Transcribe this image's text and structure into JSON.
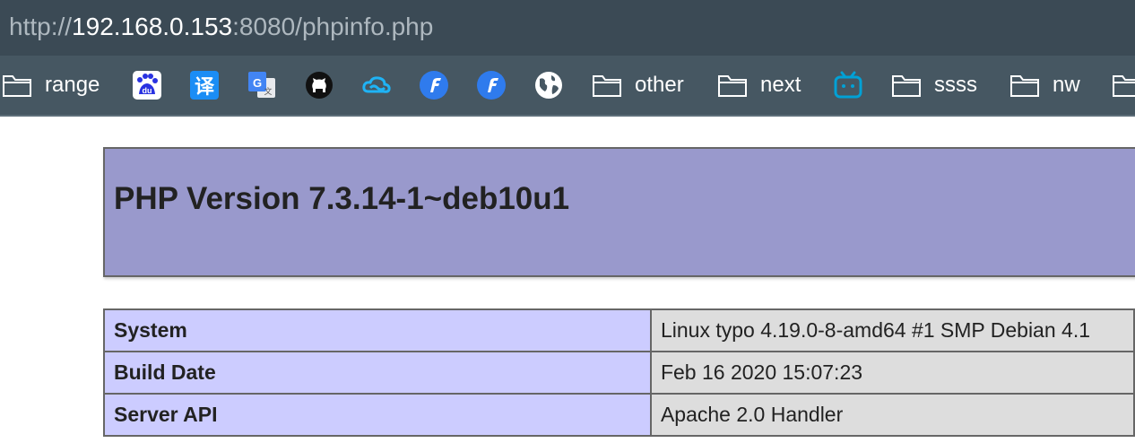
{
  "browser": {
    "url": {
      "scheme": "http://",
      "host": "192.168.0.153",
      "rest": ":8080/phpinfo.php"
    },
    "bookmarks": [
      {
        "type": "folder",
        "label": "range",
        "icon": "folder-icon"
      },
      {
        "type": "site",
        "icon": "baidu-icon",
        "glyph": "du"
      },
      {
        "type": "site",
        "icon": "translate-icon",
        "glyph": "译"
      },
      {
        "type": "site",
        "icon": "google-translate-icon",
        "glyph": "G"
      },
      {
        "type": "site",
        "icon": "github-icon"
      },
      {
        "type": "site",
        "icon": "cloud-icon"
      },
      {
        "type": "site",
        "icon": "f-app-icon"
      },
      {
        "type": "site",
        "icon": "f-app-icon"
      },
      {
        "type": "site",
        "icon": "globe-icon"
      },
      {
        "type": "folder",
        "label": "other",
        "icon": "folder-icon"
      },
      {
        "type": "folder",
        "label": "next",
        "icon": "folder-icon"
      },
      {
        "type": "site",
        "icon": "bilibili-icon"
      },
      {
        "type": "folder",
        "label": "ssss",
        "icon": "folder-icon"
      },
      {
        "type": "folder",
        "label": "nw",
        "icon": "folder-icon"
      },
      {
        "type": "folder",
        "label": "",
        "icon": "folder-icon"
      }
    ]
  },
  "page": {
    "title": "PHP Version 7.3.14-1~deb10u1",
    "rows": [
      {
        "label": "System",
        "value": "Linux typo 4.19.0-8-amd64 #1 SMP Debian 4.1"
      },
      {
        "label": "Build Date",
        "value": "Feb 16 2020 15:07:23"
      },
      {
        "label": "Server API",
        "value": "Apache 2.0 Handler"
      }
    ]
  },
  "colors": {
    "address_bar": "#3b4a55",
    "bookmarks_bar": "#465762",
    "header_bg": "#9999cc",
    "label_cell_bg": "#ccccff",
    "value_cell_bg": "#dddddd"
  }
}
